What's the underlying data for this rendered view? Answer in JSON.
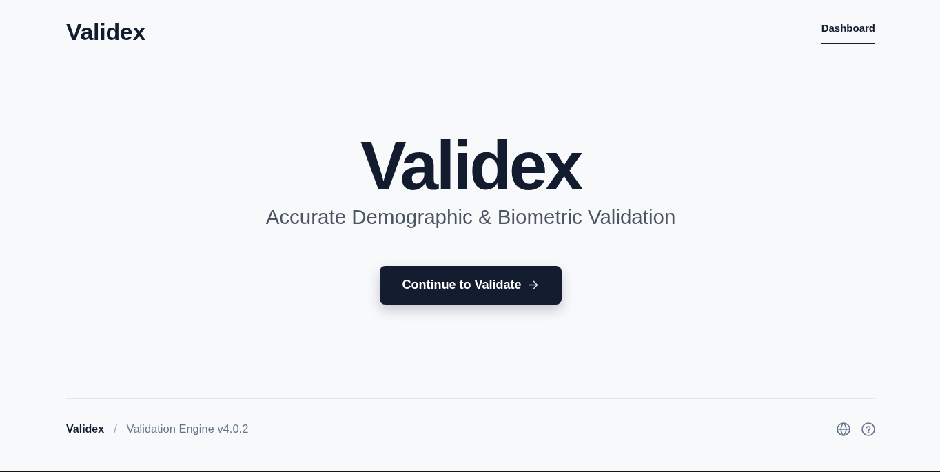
{
  "header": {
    "brand": "Validex",
    "nav": [
      {
        "label": "Dashboard",
        "selected": true
      }
    ]
  },
  "hero": {
    "title": "Validex",
    "subtitle": "Accurate Demographic & Biometric Validation",
    "button": {
      "label": "Continue to Validate"
    }
  },
  "footer": {
    "brand": "Validex",
    "separator": "/",
    "version": "Validation Engine v4.0.2"
  }
}
